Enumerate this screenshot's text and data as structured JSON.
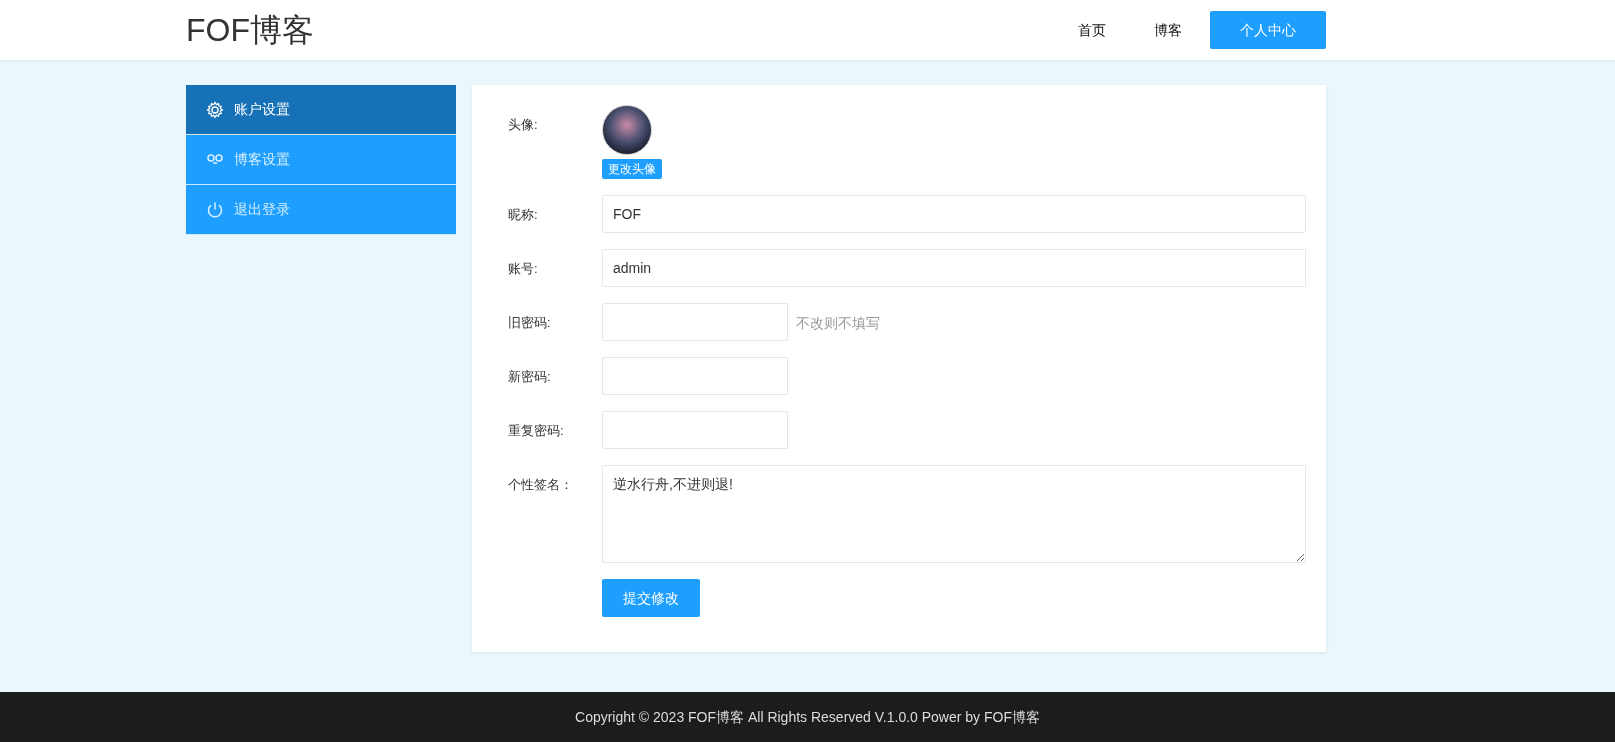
{
  "header": {
    "logo": "FOF博客",
    "nav": [
      {
        "label": "首页",
        "selected": false
      },
      {
        "label": "博客",
        "selected": false
      },
      {
        "label": "个人中心",
        "selected": true
      }
    ]
  },
  "sidebar": {
    "items": [
      {
        "label": "账户设置",
        "kind": "gear",
        "selected": true
      },
      {
        "label": "博客设置",
        "kind": "link",
        "selected": false
      },
      {
        "label": "退出登录",
        "kind": "power",
        "selected": false
      }
    ]
  },
  "form": {
    "avatar": {
      "label": "头像:",
      "button": "更改头像"
    },
    "fields": [
      {
        "kind": "text",
        "label": "昵称:",
        "value": "FOF"
      },
      {
        "kind": "text",
        "label": "账号:",
        "value": "admin"
      },
      {
        "kind": "password",
        "label": "旧密码:",
        "hint": "不改则不填写"
      },
      {
        "kind": "password",
        "label": "新密码:"
      },
      {
        "kind": "password",
        "label": "重复密码:"
      },
      {
        "kind": "textarea",
        "label": "个性签名：",
        "value": "逆水行舟,不进则退!"
      }
    ],
    "submit": "提交修改"
  },
  "footer": "Copyright © 2023 FOF博客 All Rights Reserved V.1.0.0 Power by FOF博客"
}
